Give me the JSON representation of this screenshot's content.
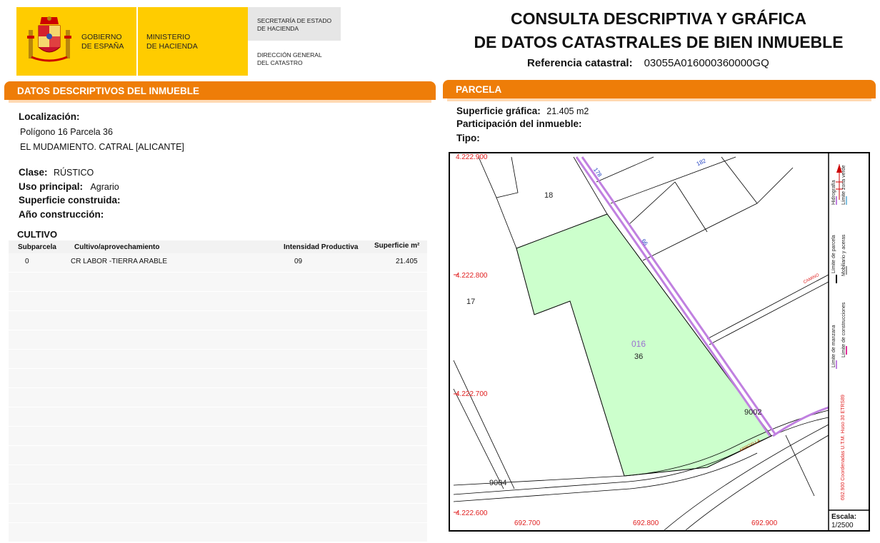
{
  "header": {
    "gobierno": [
      "GOBIERNO",
      "DE ESPAÑA"
    ],
    "ministerio": [
      "MINISTERIO",
      "DE HACIENDA"
    ],
    "secretaria": [
      "SECRETARÍA DE ESTADO",
      "DE HACIENDA"
    ],
    "direccion": [
      "DIRECCIÓN GENERAL",
      "DEL CATASTRO"
    ],
    "title_line1": "CONSULTA DESCRIPTIVA Y GRÁFICA",
    "title_line2": "DE DATOS CATASTRALES DE BIEN INMUEBLE",
    "ref_label": "Referencia catastral:",
    "ref_value": "03055A016000360000GQ"
  },
  "left": {
    "bar_title": "DATOS DESCRIPTIVOS DEL INMUEBLE",
    "localizacion_label": "Localización:",
    "loc_line1": "Polígono 16 Parcela 36",
    "loc_line2": "EL MUDAMIENTO. CATRAL [ALICANTE]",
    "clase_label": "Clase:",
    "clase_value": "RÚSTICO",
    "uso_label": "Uso principal:",
    "uso_value": "Agrario",
    "sup_construida_label": "Superficie construida:",
    "anio_label": "Año construcción:",
    "cultivo_title": "CULTIVO",
    "table_headers": [
      "Subparcela",
      "Cultivo/aprovechamiento",
      "Intensidad Productiva",
      "Superficie m²"
    ],
    "rows": [
      {
        "subparcela": "0",
        "cultivo": "CR LABOR -TIERRA ARABLE",
        "intensidad": "09",
        "superficie": "21.405"
      }
    ]
  },
  "right": {
    "bar_title": "PARCELA",
    "sup_grafica_label": "Superficie gráfica:",
    "sup_grafica_value": "21.405 m2",
    "participacion_label": "Participación del inmueble:",
    "tipo_label": "Tipo:"
  },
  "map": {
    "y_coords": [
      "4.222.900",
      "4.222.800",
      "4.222.700",
      "4.222.600"
    ],
    "x_coords": [
      "692.700",
      "692.800",
      "692.900"
    ],
    "labels": {
      "poligono": "016",
      "parcela": "36",
      "p18": "18",
      "p17": "17",
      "p9002": "9002",
      "p9004": "9004",
      "road_178": "178",
      "road_182": "182",
      "road_66": "66",
      "camino": "CAMINO",
      "acequia": "ARROYLLA"
    },
    "legend": {
      "col1": [
        "Límite de manzana",
        "Límite de parcela",
        "Hidrografía"
      ],
      "col2": [
        "Límite de construcciones",
        "Mobiliario y aceras",
        "Límite zona verde"
      ],
      "coords_note": "692.900 Coordenadas U.T.M. Huso 30 ETRS89"
    },
    "scale_label": "Escala:",
    "scale_value": "1/2500"
  }
}
